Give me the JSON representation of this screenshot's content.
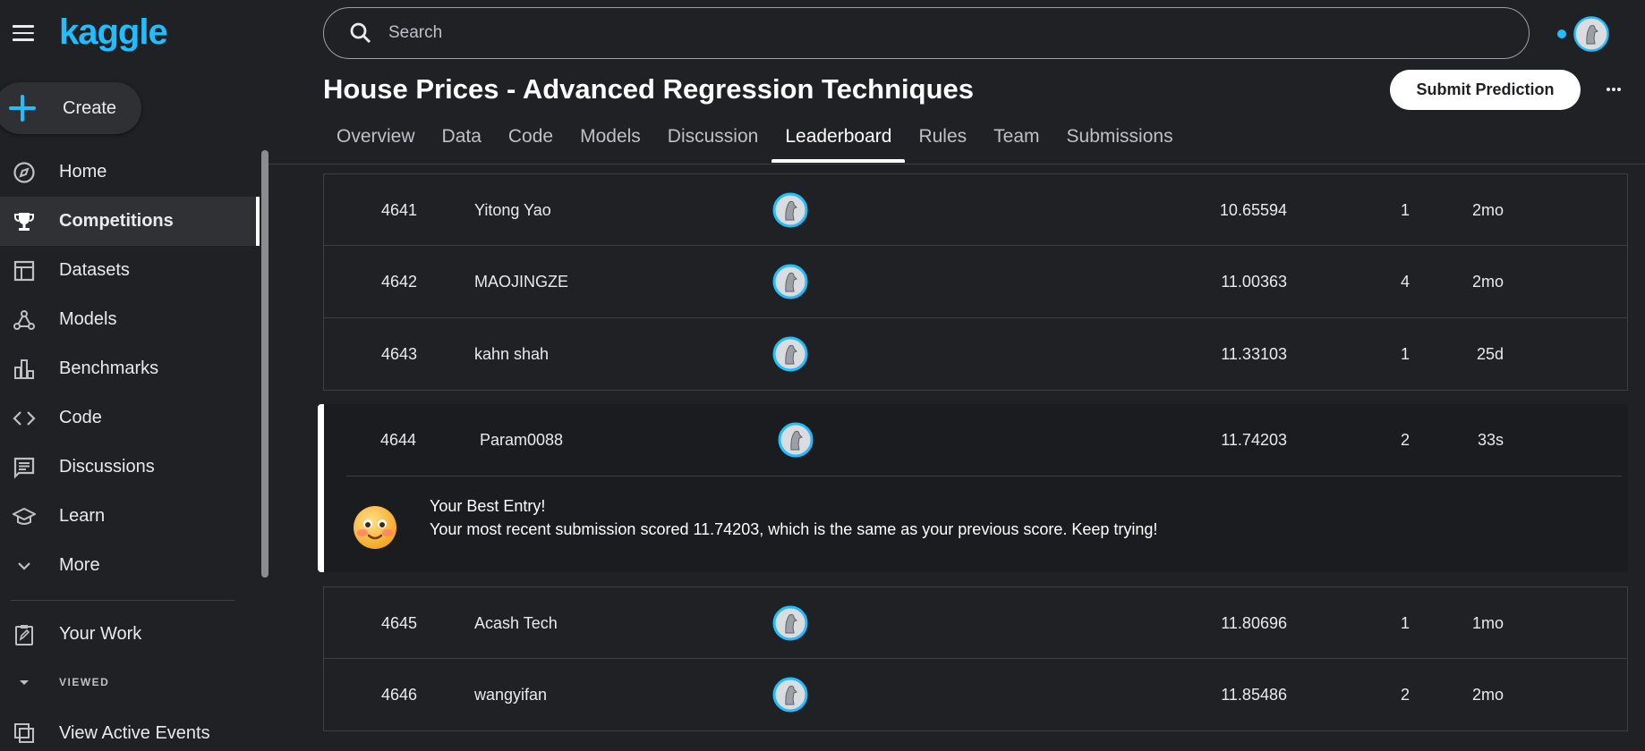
{
  "brand": {
    "logo": "kaggle",
    "accent": "#20beff"
  },
  "sidebar": {
    "create_label": "Create",
    "items": [
      {
        "label": "Home",
        "icon": "compass-icon"
      },
      {
        "label": "Competitions",
        "icon": "trophy-icon",
        "active": true
      },
      {
        "label": "Datasets",
        "icon": "table-icon"
      },
      {
        "label": "Models",
        "icon": "models-icon"
      },
      {
        "label": "Benchmarks",
        "icon": "bar-chart-icon"
      },
      {
        "label": "Code",
        "icon": "code-icon"
      },
      {
        "label": "Discussions",
        "icon": "comment-icon"
      },
      {
        "label": "Learn",
        "icon": "school-icon"
      },
      {
        "label": "More",
        "icon": "chevron-down-icon"
      }
    ],
    "your_work": "Your Work",
    "viewed_label": "VIEWED",
    "view_active_events": "View Active Events"
  },
  "header": {
    "search_placeholder": "Search"
  },
  "competition": {
    "title": "House Prices - Advanced Regression Techniques",
    "submit_label": "Submit Prediction",
    "tabs": [
      "Overview",
      "Data",
      "Code",
      "Models",
      "Discussion",
      "Leaderboard",
      "Rules",
      "Team",
      "Submissions"
    ],
    "active_tab": "Leaderboard"
  },
  "leaderboard": {
    "rows_above": [
      {
        "rank": "4641",
        "team": "Yitong Yao",
        "score": "10.65594",
        "entries": "1",
        "last": "2mo"
      },
      {
        "rank": "4642",
        "team": "MAOJINGZE",
        "score": "11.00363",
        "entries": "4",
        "last": "2mo"
      },
      {
        "rank": "4643",
        "team": "kahn shah",
        "score": "11.33103",
        "entries": "1",
        "last": "25d"
      }
    ],
    "my_row": {
      "rank": "4644",
      "team": "Param0088",
      "score": "11.74203",
      "entries": "2",
      "last": "33s"
    },
    "message_title": "Your Best Entry!",
    "message_body": "Your most recent submission scored 11.74203, which is the same as your previous score. Keep trying!",
    "rows_below": [
      {
        "rank": "4645",
        "team": "Acash Tech",
        "score": "11.80696",
        "entries": "1",
        "last": "1mo"
      },
      {
        "rank": "4646",
        "team": "wangyifan",
        "score": "11.85486",
        "entries": "2",
        "last": "2mo"
      }
    ]
  }
}
